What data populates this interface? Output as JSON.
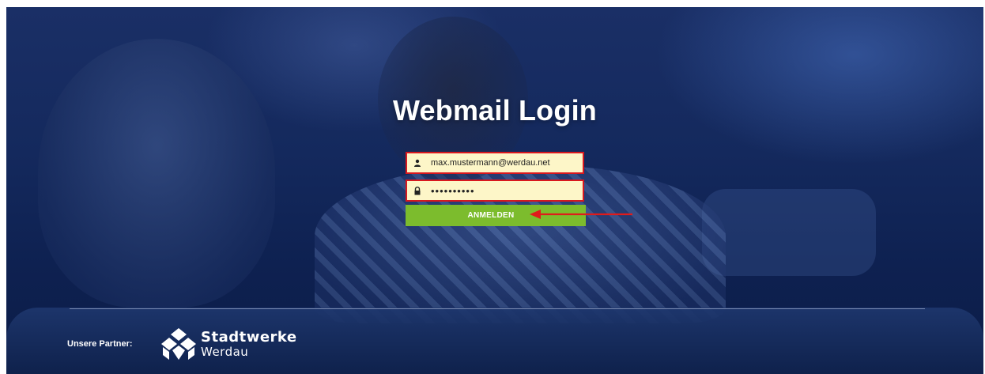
{
  "page": {
    "title": "Webmail Login"
  },
  "form": {
    "username_value": "max.mustermann@werdau.net",
    "password_value": "••••••••••",
    "submit_label": "ANMELDEN",
    "user_icon": "user-icon",
    "lock_icon": "lock-icon"
  },
  "footer": {
    "partner_label": "Unsere Partner:",
    "partner_name_line1": "Stadtwerke",
    "partner_name_line2": "Werdau"
  },
  "colors": {
    "field_border": "#d8181e",
    "field_background": "#fdf6c8",
    "button_green": "#7cbc2d",
    "annotation_arrow": "#e01b1b"
  }
}
